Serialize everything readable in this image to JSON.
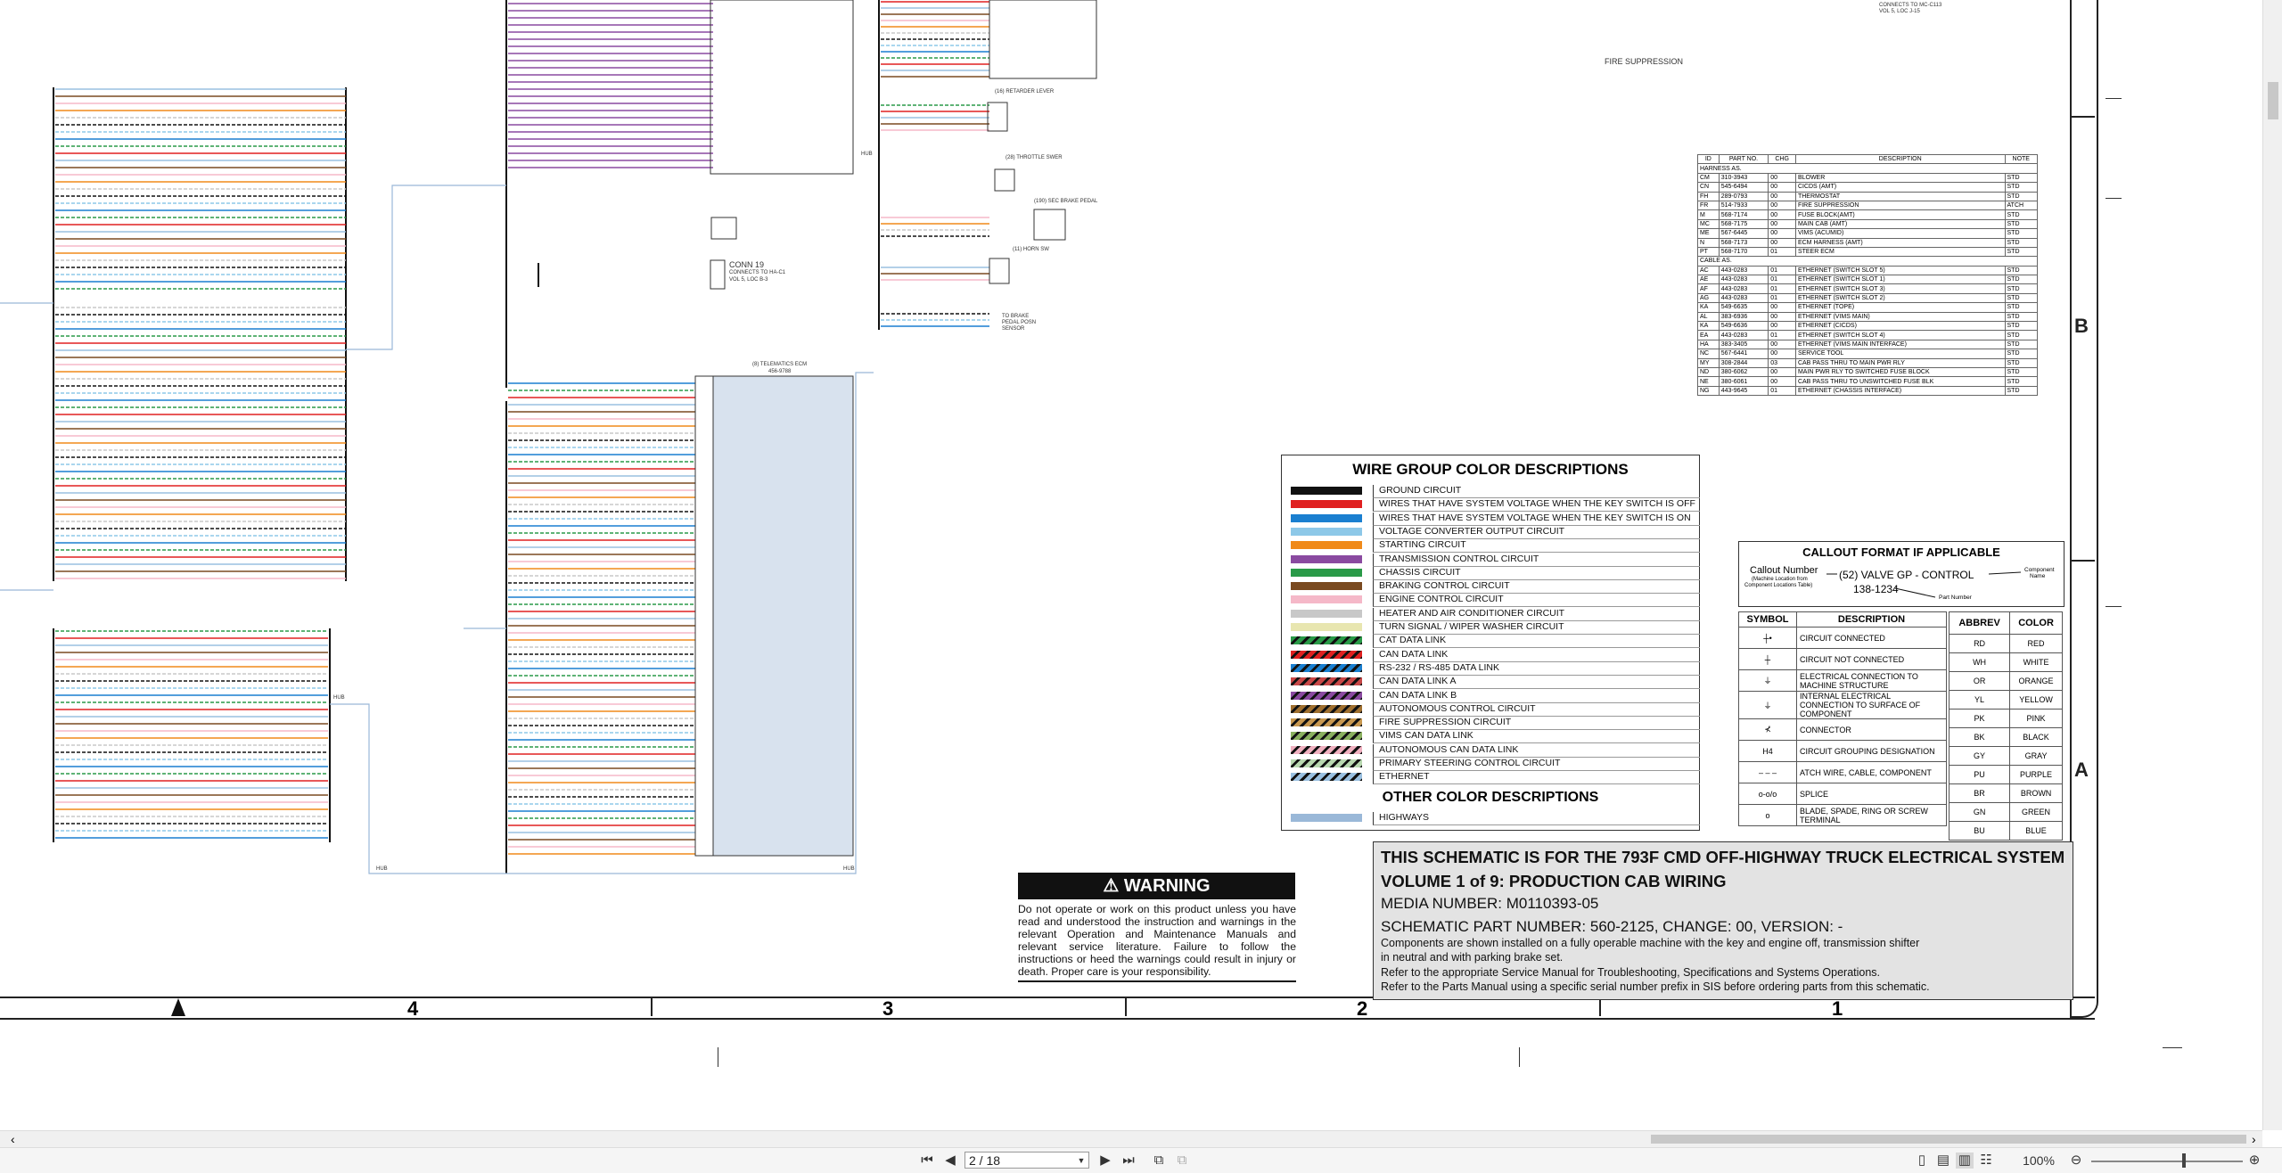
{
  "schematic": {
    "fire_suppression_label": "FIRE SUPPRESSION",
    "conn_block": {
      "title": "CONN 19",
      "line1": "CONNECTS TO HA-C1",
      "line2": "VOL 5, LOC B-3"
    },
    "top_right_note": {
      "line1": "CONNECTS TO MC-C113",
      "line2": "VOL 5, LOC J-15"
    },
    "telematics_ecm_label": "(8) TELEMATICS ECM",
    "telematics_ecm_part": "456-9788",
    "retarder_label": "(16) RETARDER LEVER",
    "throttle_label": "(28) THROTTLE SWER",
    "brake_label": "(190) SEC BRAKE PEDAL",
    "horn_label": "(11) HORN SW",
    "pedal_label": {
      "line1": "TO BRAKE",
      "line2": "PEDAL POSN",
      "line3": "SENSOR"
    },
    "hub_label": "HUB"
  },
  "legend": {
    "title": "WIRE GROUP COLOR DESCRIPTIONS",
    "items": [
      {
        "label": "GROUND CIRCUIT",
        "color": "#111111",
        "pattern": "solid"
      },
      {
        "label": "WIRES THAT HAVE SYSTEM VOLTAGE WHEN THE KEY SWITCH IS OFF",
        "color": "#e02020",
        "pattern": "solid"
      },
      {
        "label": "WIRES THAT HAVE SYSTEM VOLTAGE WHEN THE KEY SWITCH IS ON",
        "color": "#1a7fd0",
        "pattern": "solid"
      },
      {
        "label": "VOLTAGE CONVERTER OUTPUT CIRCUIT",
        "color": "#8dc8e8",
        "pattern": "solid"
      },
      {
        "label": "STARTING CIRCUIT",
        "color": "#f08a1a",
        "pattern": "solid"
      },
      {
        "label": "TRANSMISSION CONTROL CIRCUIT",
        "color": "#8a4aa0",
        "pattern": "solid"
      },
      {
        "label": "CHASSIS CIRCUIT",
        "color": "#2a9a48",
        "pattern": "solid"
      },
      {
        "label": "BRAKING CONTROL CIRCUIT",
        "color": "#7a4a20",
        "pattern": "solid"
      },
      {
        "label": "ENGINE CONTROL CIRCUIT",
        "color": "#f5b8c8",
        "pattern": "solid"
      },
      {
        "label": "HEATER AND AIR CONDITIONER CIRCUIT",
        "color": "#c8c8c8",
        "pattern": "solid"
      },
      {
        "label": "TURN SIGNAL / WIPER WASHER CIRCUIT",
        "color": "#e8e6b0",
        "pattern": "solid"
      },
      {
        "label": "CAT DATA LINK",
        "color": "#2a9a48",
        "pattern": "stripe"
      },
      {
        "label": "CAN DATA LINK",
        "color": "#e02020",
        "pattern": "stripe"
      },
      {
        "label": "RS-232 / RS-485 DATA LINK",
        "color": "#1a7fd0",
        "pattern": "stripe"
      },
      {
        "label": "CAN DATA LINK A",
        "color": "#c84848",
        "pattern": "stripe"
      },
      {
        "label": "CAN DATA LINK B",
        "color": "#8a4aa0",
        "pattern": "stripe"
      },
      {
        "label": "AUTONOMOUS CONTROL CIRCUIT",
        "color": "#a07030",
        "pattern": "stripe"
      },
      {
        "label": "FIRE SUPPRESSION CIRCUIT",
        "color": "#c89850",
        "pattern": "stripe"
      },
      {
        "label": "VIMS CAN DATA LINK",
        "color": "#8ab060",
        "pattern": "stripe"
      },
      {
        "label": "AUTONOMOUS CAN DATA LINK",
        "color": "#f0b0c0",
        "pattern": "stripe"
      },
      {
        "label": "PRIMARY STEERING CONTROL CIRCUIT",
        "color": "#b8d8b0",
        "pattern": "stripe"
      },
      {
        "label": "ETHERNET",
        "color": "#9ac0e0",
        "pattern": "stripe"
      }
    ],
    "other_title": "OTHER COLOR DESCRIPTIONS",
    "other_items": [
      {
        "label": "HIGHWAYS",
        "color": "#9ab8d8",
        "pattern": "solid"
      }
    ]
  },
  "parts_table": {
    "headers": [
      "ID",
      "PART NO.",
      "CHG",
      "DESCRIPTION",
      "NOTE"
    ],
    "section1": "HARNESS AS.",
    "rows1": [
      [
        "CM",
        "310-3943",
        "00",
        "BLOWER",
        "STD"
      ],
      [
        "CN",
        "545-6494",
        "00",
        "CICDS (AMT)",
        "STD"
      ],
      [
        "FH",
        "289-0793",
        "00",
        "THERMOSTAT",
        "STD"
      ],
      [
        "FR",
        "514-7933",
        "00",
        "FIRE SUPPRESSION",
        "ATCH"
      ],
      [
        "M",
        "568-7174",
        "00",
        "FUSE BLOCK(AMT)",
        "STD"
      ],
      [
        "MC",
        "568-7175",
        "00",
        "MAIN CAB (AMT)",
        "STD"
      ],
      [
        "ME",
        "567-6445",
        "00",
        "VIMS (ACUMID)",
        "STD"
      ],
      [
        "N",
        "568-7173",
        "00",
        "ECM HARNESS (AMT)",
        "STD"
      ],
      [
        "PT",
        "568-7170",
        "01",
        "STEER ECM",
        "STD"
      ]
    ],
    "section2": "CABLE AS.",
    "rows2": [
      [
        "AC",
        "443-0283",
        "01",
        "ETHERNET (SWITCH SLOT 5)",
        "STD"
      ],
      [
        "AE",
        "443-0283",
        "01",
        "ETHERNET (SWITCH SLOT 1)",
        "STD"
      ],
      [
        "AF",
        "443-0283",
        "01",
        "ETHERNET (SWITCH SLOT 3)",
        "STD"
      ],
      [
        "AG",
        "443-0283",
        "01",
        "ETHERNET (SWITCH SLOT 2)",
        "STD"
      ],
      [
        "KA",
        "549-6635",
        "00",
        "ETHERNET (TOPE)",
        "STD"
      ],
      [
        "AL",
        "383-6936",
        "00",
        "ETHERNET (VIMS MAIN)",
        "STD"
      ],
      [
        "KA",
        "549-6636",
        "00",
        "ETHERNET (CICDS)",
        "STD"
      ],
      [
        "EA",
        "443-0283",
        "01",
        "ETHERNET (SWITCH SLOT 4)",
        "STD"
      ],
      [
        "HA",
        "383-3405",
        "00",
        "ETHERNET (VIMS MAIN INTERFACE)",
        "STD"
      ],
      [
        "NC",
        "567-6441",
        "00",
        "SERVICE TOOL",
        "STD"
      ],
      [
        "MY",
        "308-2844",
        "03",
        "CAB PASS THRU TO MAIN PWR RLY",
        "STD"
      ],
      [
        "ND",
        "380-6062",
        "00",
        "MAIN PWR RLY TO SWITCHED FUSE BLOCK",
        "STD"
      ],
      [
        "NE",
        "380-6061",
        "00",
        "CAB PASS THRU TO UNSWITCHED FUSE BLK",
        "STD"
      ],
      [
        "NG",
        "443-9645",
        "01",
        "ETHERNET (CHASSIS INTERFACE)",
        "STD"
      ]
    ]
  },
  "callout": {
    "title": "CALLOUT FORMAT IF APPLICABLE",
    "callout_number": "Callout Number",
    "machine_location": "(Machine Location from",
    "component_locations": "Component Locations Table)",
    "example": "(52) VALVE GP - CONTROL",
    "example_part": "138-1234",
    "component_name": "Component",
    "component_name2": "Name",
    "part_number": "Part Number"
  },
  "symbols": {
    "headers": [
      "SYMBOL",
      "DESCRIPTION"
    ],
    "rows": [
      {
        "sym": "┼•",
        "desc": "CIRCUIT CONNECTED"
      },
      {
        "sym": "┼",
        "desc": "CIRCUIT NOT CONNECTED"
      },
      {
        "sym": "⏚",
        "desc": "ELECTRICAL CONNECTION TO MACHINE STRUCTURE"
      },
      {
        "sym": "⏚",
        "desc": "INTERNAL ELECTRICAL CONNECTION TO SURFACE OF COMPONENT"
      },
      {
        "sym": "⊀",
        "desc": "CONNECTOR"
      },
      {
        "sym": "H4",
        "desc": "CIRCUIT GROUPING DESIGNATION"
      },
      {
        "sym": "– – –",
        "desc": "ATCH WIRE, CABLE, COMPONENT"
      },
      {
        "sym": "o-o/o",
        "desc": "SPLICE"
      },
      {
        "sym": "o",
        "desc": "BLADE, SPADE, RING OR SCREW TERMINAL"
      }
    ]
  },
  "abbrev": {
    "headers": [
      "ABBREV",
      "COLOR"
    ],
    "rows": [
      [
        "RD",
        "RED"
      ],
      [
        "WH",
        "WHITE"
      ],
      [
        "OR",
        "ORANGE"
      ],
      [
        "YL",
        "YELLOW"
      ],
      [
        "PK",
        "PINK"
      ],
      [
        "BK",
        "BLACK"
      ],
      [
        "GY",
        "GRAY"
      ],
      [
        "PU",
        "PURPLE"
      ],
      [
        "BR",
        "BROWN"
      ],
      [
        "GN",
        "GREEN"
      ],
      [
        "BU",
        "BLUE"
      ]
    ]
  },
  "title_block": {
    "line1": "THIS SCHEMATIC IS FOR THE 793F CMD OFF-HIGHWAY TRUCK ELECTRICAL SYSTEM",
    "line2": "VOLUME 1 of 9: PRODUCTION CAB WIRING",
    "media": "MEDIA NUMBER: M0110393-05",
    "part": "SCHEMATIC PART NUMBER: 560-2125, CHANGE: 00, VERSION: -",
    "note1": "Components are shown installed on a fully operable machine with the key and engine off, transmission shifter",
    "note2": "in neutral and with parking brake set.",
    "note3": "Refer to the appropriate Service Manual for Troubleshooting, Specifications and Systems Operations.",
    "note4": "Refer to the Parts Manual using a specific serial number prefix in SIS before ordering parts from this schematic."
  },
  "warning": {
    "title": "WARNING",
    "body": "Do not operate or work on this product unless you have read and understood the instruction and warnings in the relevant Operation and Maintenance Manuals and relevant service literature. Failure to follow the instructions or heed the warnings could result in injury or death. Proper care is your responsibility."
  },
  "zones": {
    "rows": [
      "B",
      "A"
    ],
    "cols": [
      "4",
      "3",
      "2",
      "1"
    ]
  },
  "viewer": {
    "page_value": "2 / 18",
    "zoom": "100%"
  }
}
